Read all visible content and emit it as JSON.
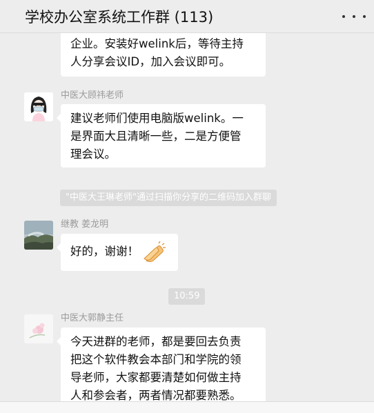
{
  "header": {
    "title": "学校办公室系统工作群 (113)",
    "more_icon": "more-dots-icon"
  },
  "messages": [
    {
      "lines": [
        "企业。安装好welink后，等待主持",
        "人分享会议ID，加入会议即可。"
      ]
    },
    {
      "sender": "中医大顾祎老师",
      "avatar": "cartoon-woman-avatar",
      "lines": [
        "建议老师们使用电脑版welink。一",
        "是界面大且清晰一些，二是方便管",
        "理会议。"
      ]
    },
    {
      "system": "\"中医大王琳老师\"通过扫描你分享的二维码加入群聊"
    },
    {
      "sender": "继教 姜龙明",
      "avatar": "landscape-avatar",
      "text": "好的，谢谢！",
      "emoji": "clapping-hands-emoji"
    },
    {
      "time": "10:59"
    },
    {
      "sender": "中医大郭静主任",
      "avatar": "flower-avatar",
      "lines": [
        "今天进群的老师，都是要回去负责",
        "把这个软件教会本部门和学院的领",
        "导老师，大家都要清楚如何做主持",
        "人和参会者，两者情况都要熟悉。"
      ]
    }
  ],
  "colors": {
    "background": "#ededed",
    "bubble": "#ffffff",
    "system_bg": "#dadada",
    "sender": "#9b9b9b"
  }
}
